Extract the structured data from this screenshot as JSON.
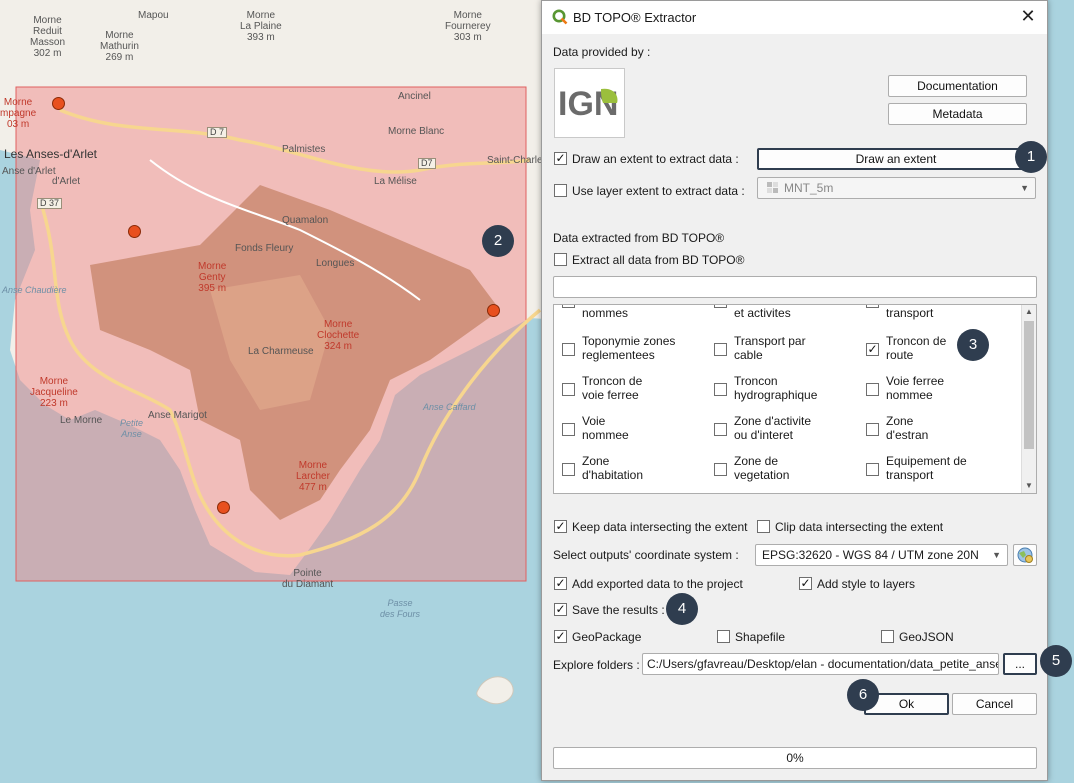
{
  "map": {
    "labels": [
      {
        "text": "Mapou",
        "kind": "plain"
      },
      {
        "text": "Morne\nReduit\nMasson\n302 m",
        "kind": "plain"
      },
      {
        "text": "Morne\nLa Plaine\n393 m",
        "kind": "plain"
      },
      {
        "text": "Morne\nFournerey\n303 m",
        "kind": "plain"
      },
      {
        "text": "Morne\nMathurin\n269 m",
        "kind": "plain"
      },
      {
        "text": "Morne\nmpagne\n03 m",
        "kind": "red"
      },
      {
        "text": "Ancinel",
        "kind": "plain"
      },
      {
        "text": "Morne Blanc",
        "kind": "plain"
      },
      {
        "text": "Palmistes",
        "kind": "plain"
      },
      {
        "text": "Les Anses-d'Arlet",
        "kind": "town"
      },
      {
        "text": "Saint-Charles",
        "kind": "plain"
      },
      {
        "text": "La Mélise",
        "kind": "plain"
      },
      {
        "text": "Quamalon",
        "kind": "plain"
      },
      {
        "text": "Fonds Fleury",
        "kind": "plain"
      },
      {
        "text": "Longues",
        "kind": "plain"
      },
      {
        "text": "Morne\nGenty\n395 m",
        "kind": "red"
      },
      {
        "text": "Morne\nClochette\n324 m",
        "kind": "red"
      },
      {
        "text": "La Charmeuse",
        "kind": "plain"
      },
      {
        "text": "Morne\nJacqueline\n223 m",
        "kind": "red"
      },
      {
        "text": "Morne\nLarcher\n477 m",
        "kind": "red"
      },
      {
        "text": "Pointe\ndu Diamant",
        "kind": "plain"
      },
      {
        "text": "Anse Chaudière",
        "kind": "sea"
      },
      {
        "text": "Anse Caffard",
        "kind": "sea"
      },
      {
        "text": "Anse Marigot",
        "kind": "plain"
      },
      {
        "text": "Petite\nAnse",
        "kind": "sea"
      },
      {
        "text": "Passe\ndes Fours",
        "kind": "sea"
      },
      {
        "text": "D 7",
        "kind": "road"
      },
      {
        "text": "D7",
        "kind": "road"
      },
      {
        "text": "D 37",
        "kind": "road"
      },
      {
        "text": "d'Arlet",
        "kind": "plain"
      },
      {
        "text": "Anse d'Arlet",
        "kind": "plain"
      },
      {
        "text": "Le Morne",
        "kind": "plain"
      }
    ],
    "extent_color": "#f08080"
  },
  "dialog": {
    "title": "BD TOPO® Extractor",
    "provided_by": "Data provided by :",
    "logo_text": "IGN",
    "documentation_btn": "Documentation",
    "metadata_btn": "Metadata",
    "draw_extent": {
      "label": "Draw an extent to extract data :",
      "checked": true,
      "button": "Draw an extent"
    },
    "layer_extent": {
      "label": "Use layer extent to extract data :",
      "checked": false,
      "layer": "MNT_5m"
    },
    "extracted_title": "Data extracted from BD TOPO®",
    "extract_all": {
      "label": "Extract all data from BD TOPO®",
      "checked": false
    },
    "filter_value": "",
    "layers_partial": [
      "nommes",
      "et activites",
      "transport"
    ],
    "layers": [
      {
        "label": "Toponymie zones\nreglementees",
        "checked": false
      },
      {
        "label": "Transport par\ncable",
        "checked": false
      },
      {
        "label": "Troncon de\nroute",
        "checked": true
      },
      {
        "label": "Troncon de\nvoie ferree",
        "checked": false
      },
      {
        "label": "Troncon\nhydrographique",
        "checked": false
      },
      {
        "label": "Voie ferree\nnommee",
        "checked": false
      },
      {
        "label": "Voie\nnommee",
        "checked": false
      },
      {
        "label": "Zone d'activite\nou d'interet",
        "checked": false
      },
      {
        "label": "Zone\nd'estran",
        "checked": false
      },
      {
        "label": "Zone\nd'habitation",
        "checked": false
      },
      {
        "label": "Zone de\nvegetation",
        "checked": false
      },
      {
        "label": "Equipement de\ntransport",
        "checked": false
      }
    ],
    "keep_intersect": {
      "label": "Keep data intersecting the extent",
      "checked": true
    },
    "clip_intersect": {
      "label": "Clip data intersecting the extent",
      "checked": false
    },
    "crs_label": "Select outputs' coordinate system :",
    "crs_value": "EPSG:32620 - WGS 84 / UTM zone 20N",
    "add_project": {
      "label": "Add exported data to the project",
      "checked": true
    },
    "add_style": {
      "label": "Add style to layers",
      "checked": true
    },
    "save_results": {
      "label": "Save the results :",
      "checked": true
    },
    "formats": [
      {
        "label": "GeoPackage",
        "checked": true
      },
      {
        "label": "Shapefile",
        "checked": false
      },
      {
        "label": "GeoJSON",
        "checked": false
      }
    ],
    "explore_label": "Explore folders :",
    "folder_path": "C:/Users/gfavreau/Desktop/elan - documentation/data_petite_anse",
    "browse_btn": "...",
    "ok_btn": "Ok",
    "cancel_btn": "Cancel",
    "progress_text": "0%",
    "progress_value": 0
  },
  "badges": [
    "1",
    "2",
    "3",
    "4",
    "5",
    "6"
  ],
  "colors": {
    "badge": "#2f3d4f",
    "marker": "#e8501f",
    "qgis_green": "#589632"
  }
}
